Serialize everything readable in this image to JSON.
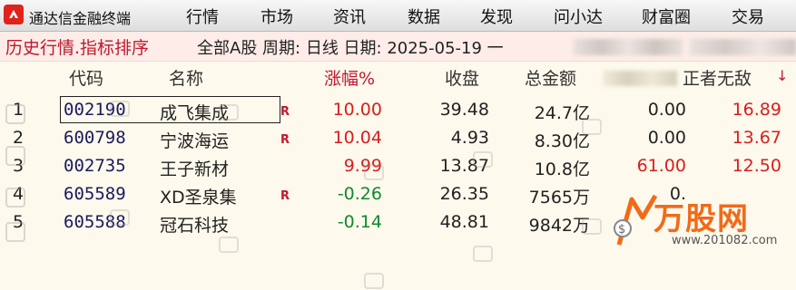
{
  "app": {
    "title": "通达信金融终端"
  },
  "menu": [
    "行情",
    "市场",
    "资讯",
    "数据",
    "发现",
    "问小达",
    "财富圈",
    "交易"
  ],
  "titleline": {
    "main": "历史行情.指标排序",
    "info": "全部A股 周期: 日线 日期: 2025-05-19 一"
  },
  "table": {
    "headers": {
      "code": "代码",
      "name": "名称",
      "change": "涨幅%",
      "close": "收盘",
      "amount": "总金额",
      "indicator": "正者无敌",
      "sort_mark": "↓"
    },
    "rows": [
      {
        "idx": "1",
        "code": "002190",
        "name": "成飞集成",
        "r": "R",
        "change": "10.00",
        "close": "39.48",
        "amount": "24.7亿",
        "col6": "0.00",
        "col7": "16.89",
        "change_color": "red",
        "col6_color": "black",
        "col7_color": "red"
      },
      {
        "idx": "2",
        "code": "600798",
        "name": "宁波海运",
        "r": "R",
        "change": "10.04",
        "close": "4.93",
        "amount": "8.30亿",
        "col6": "0.00",
        "col7": "13.67",
        "change_color": "red",
        "col6_color": "black",
        "col7_color": "red"
      },
      {
        "idx": "3",
        "code": "002735",
        "name": "王子新材",
        "r": "",
        "change": "9.99",
        "close": "13.87",
        "amount": "10.8亿",
        "col6": "61.00",
        "col7": "12.50",
        "change_color": "red",
        "col6_color": "red",
        "col7_color": "red"
      },
      {
        "idx": "4",
        "code": "605589",
        "name": "XD圣泉集",
        "r": "R",
        "change": "-0.26",
        "close": "26.35",
        "amount": "7565万",
        "col6": "0.",
        "col7": "",
        "change_color": "green",
        "col6_color": "black",
        "col7_color": "red"
      },
      {
        "idx": "5",
        "code": "605588",
        "name": "冠石科技",
        "r": "",
        "change": "-0.14",
        "close": "48.81",
        "amount": "9842万",
        "col6": "",
        "col7": "",
        "change_color": "green",
        "col6_color": "black",
        "col7_color": "red"
      }
    ]
  },
  "watermark": {
    "brand": "万股网",
    "url": "www.201082.com"
  },
  "colors": {
    "up": "#d81e1e",
    "down": "#0f8a2e",
    "accent": "#c0182e",
    "brand": "#f26a17"
  }
}
